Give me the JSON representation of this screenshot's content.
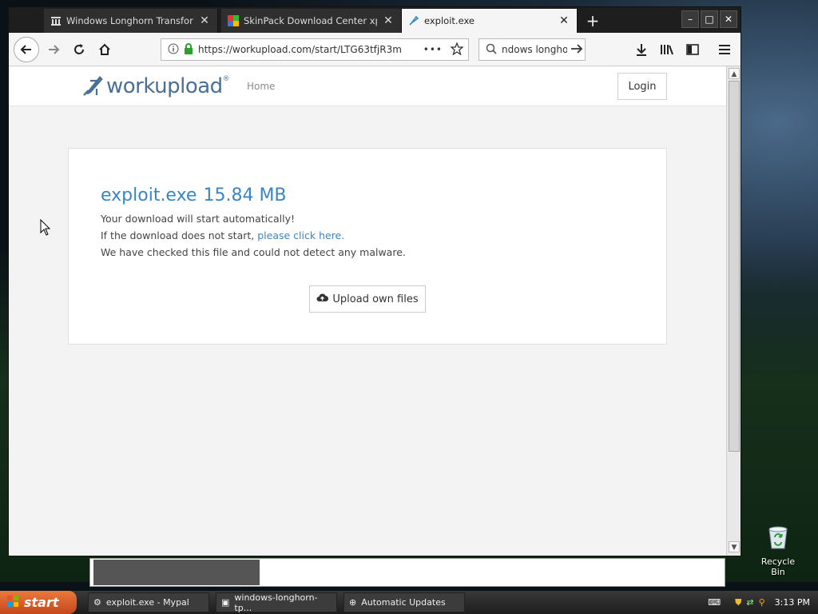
{
  "browser": {
    "tabs": [
      {
        "title": "Windows Longhorn Transformatio"
      },
      {
        "title": "SkinPack Download Center xppack"
      },
      {
        "title": "exploit.exe"
      }
    ],
    "new_tab_label": "+",
    "controls": {
      "minimize": "–",
      "maximize": "□",
      "close": "✕"
    }
  },
  "navbar": {
    "url": "https://workupload.com/start/LTG63tfjR3m",
    "page_actions": "•••",
    "search_value": "ndows longho"
  },
  "site": {
    "logo_text": "workupload",
    "logo_mark": "®",
    "nav_home": "Home",
    "login": "Login"
  },
  "card": {
    "file_name": "exploit.exe",
    "file_size": "15.84 MB",
    "line1": "Your download will start automatically!",
    "line2_prefix": "If the download does not start, ",
    "line2_link": "please click here.",
    "line3": "We have checked this file and could not detect any malware.",
    "upload_button": "Upload own files"
  },
  "desktop": {
    "recycle_bin": "Recycle Bin"
  },
  "taskbar": {
    "start": "start",
    "items": [
      {
        "label": "exploit.exe - Mypal"
      },
      {
        "label": "windows-longhorn-tp..."
      },
      {
        "label": "Automatic Updates"
      }
    ],
    "clock": "3:13 PM"
  },
  "colors": {
    "accent": "#3a86c4",
    "logo": "#4a6f96",
    "start": "#d45a26"
  }
}
